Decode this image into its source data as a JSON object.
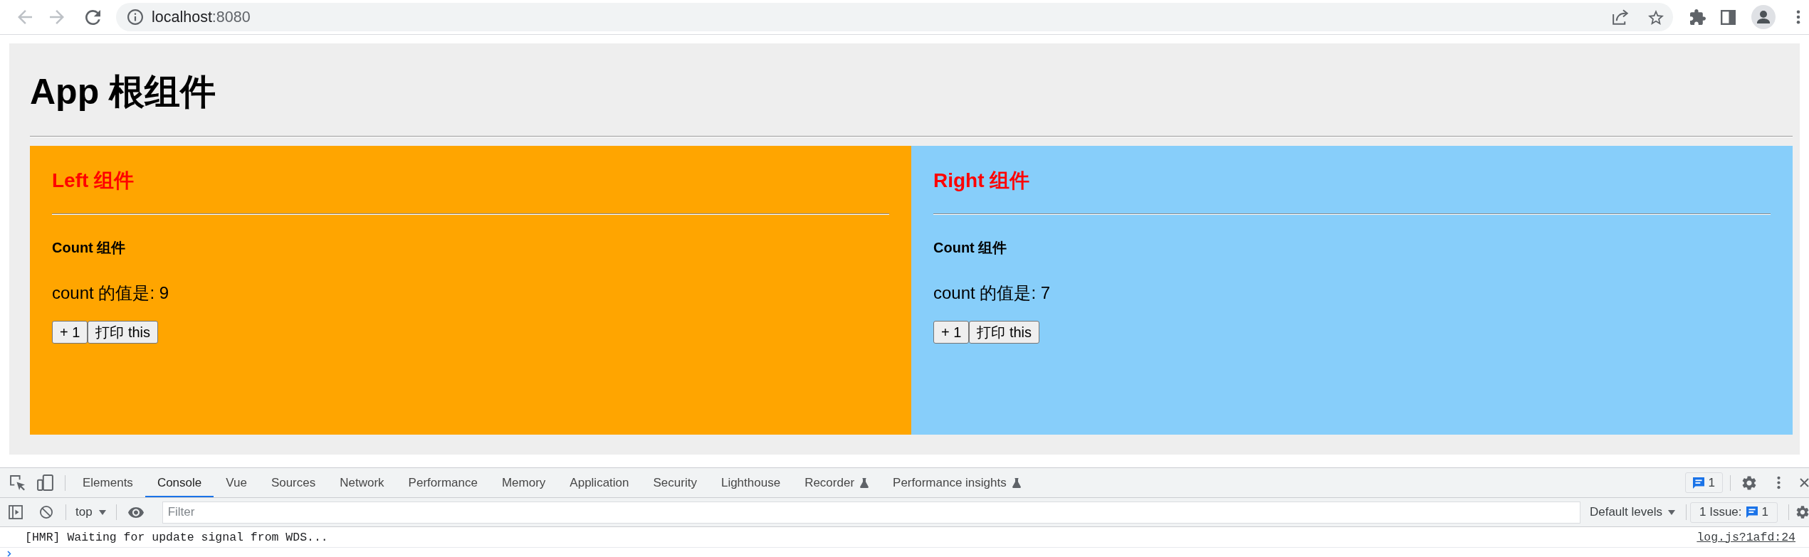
{
  "browser": {
    "host": "localhost",
    "port": ":8080"
  },
  "page": {
    "title": "App 根组件",
    "panels": [
      {
        "title": "Left 组件",
        "color": "#ffa500",
        "count_title": "Count 组件",
        "count_text": "count 的值是: 9",
        "buttons": [
          "+ 1",
          "打印 this"
        ]
      },
      {
        "title": "Right 组件",
        "color": "#87cefa",
        "count_title": "Count 组件",
        "count_text": "count 的值是: 7",
        "buttons": [
          "+ 1",
          "打印 this"
        ]
      }
    ]
  },
  "devtools": {
    "tabs": [
      {
        "label": "Elements",
        "selected": false,
        "experimental": false
      },
      {
        "label": "Console",
        "selected": true,
        "experimental": false
      },
      {
        "label": "Vue",
        "selected": false,
        "experimental": false
      },
      {
        "label": "Sources",
        "selected": false,
        "experimental": false
      },
      {
        "label": "Network",
        "selected": false,
        "experimental": false
      },
      {
        "label": "Performance",
        "selected": false,
        "experimental": false
      },
      {
        "label": "Memory",
        "selected": false,
        "experimental": false
      },
      {
        "label": "Application",
        "selected": false,
        "experimental": false
      },
      {
        "label": "Security",
        "selected": false,
        "experimental": false
      },
      {
        "label": "Lighthouse",
        "selected": false,
        "experimental": false
      },
      {
        "label": "Recorder",
        "selected": false,
        "experimental": true
      },
      {
        "label": "Performance insights",
        "selected": false,
        "experimental": true
      }
    ],
    "message_count": "1",
    "context": "top",
    "filter": {
      "placeholder": "Filter"
    },
    "levels": "Default levels",
    "issues": {
      "label": "1 Issue:",
      "count": "1"
    },
    "messages": [
      {
        "text": "[HMR] Waiting for update signal from WDS...",
        "source": "log.js?1afd:24"
      }
    ]
  }
}
